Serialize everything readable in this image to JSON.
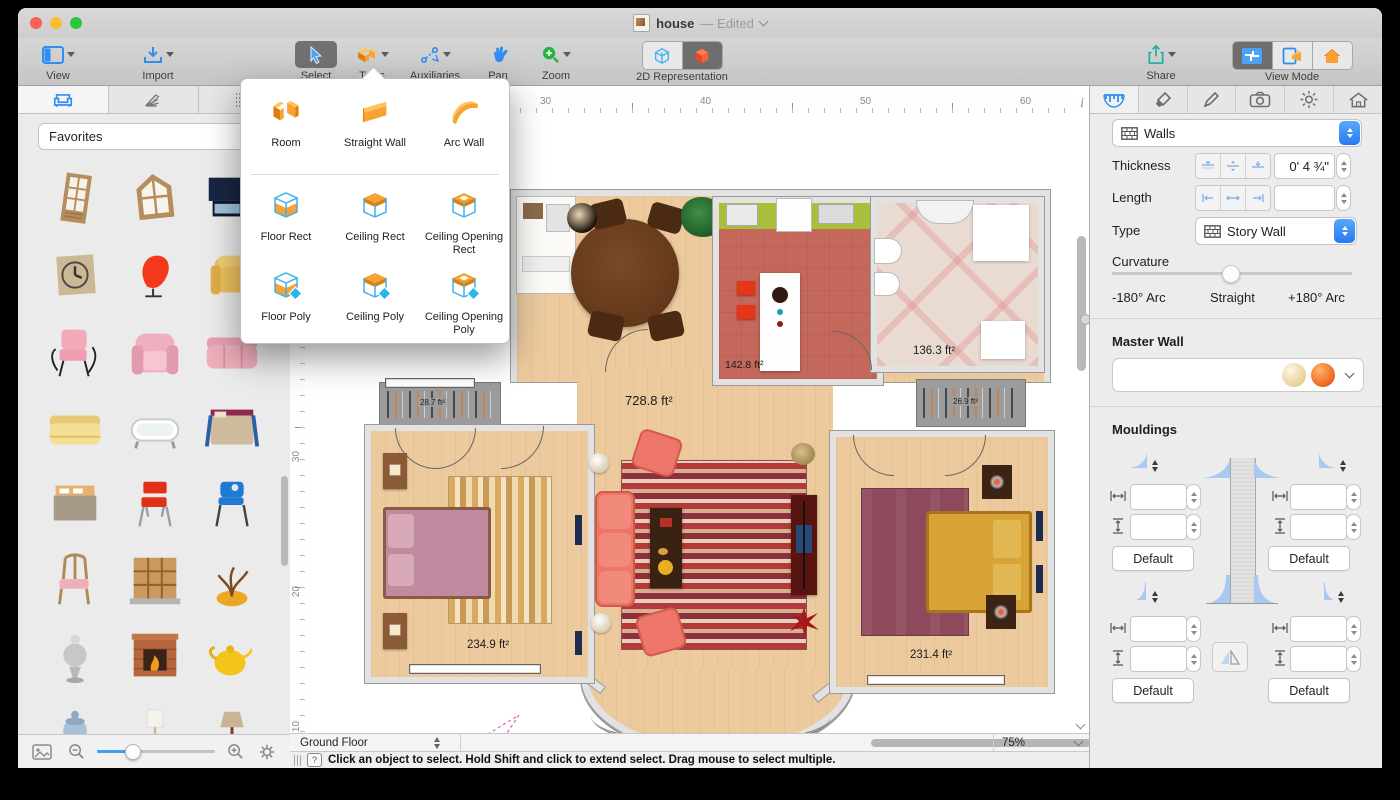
{
  "window": {
    "title": "house",
    "edited_suffix": "— Edited"
  },
  "toolbar": {
    "view": "View",
    "import": "Import",
    "select": "Select",
    "tools": "Tools",
    "auxiliaries": "Auxiliaries",
    "pan": "Pan",
    "zoom": "Zoom",
    "representation_2d": "2D Representation",
    "share": "Share",
    "view_mode": "View Mode"
  },
  "tools_popover": {
    "items": [
      {
        "label": "Room"
      },
      {
        "label": "Straight Wall"
      },
      {
        "label": "Arc Wall"
      },
      {
        "label": "Floor Rect"
      },
      {
        "label": "Ceiling Rect"
      },
      {
        "label": "Ceiling Opening Rect"
      },
      {
        "label": "Floor Poly"
      },
      {
        "label": "Ceiling Poly"
      },
      {
        "label": "Ceiling Opening Poly"
      }
    ]
  },
  "library": {
    "category": "Favorites",
    "items": [
      "door",
      "arched-window",
      "tv-stand",
      "wall-clock",
      "egg-chair",
      "armchair-yellow",
      "chair-pink-metal",
      "armchair-pink",
      "sofa-pink",
      "sofa-yellow",
      "bathtub",
      "bed-blue",
      "bed-gray",
      "chair-red",
      "chair-blue",
      "chair-wood",
      "shelving-unit",
      "bonsai-tree",
      "samovar",
      "fireplace",
      "teapot",
      "jar-blue",
      "floor-lamp",
      "table-lamp"
    ]
  },
  "canvas": {
    "ruler_top": [
      "30",
      "40",
      "50",
      "60"
    ],
    "ruler_left": [
      "30",
      "20",
      "10"
    ],
    "info_glyph": "i",
    "areas": {
      "living": "728.8 ft²",
      "kitchen": "142.8 ft²",
      "bathroom": "136.3 ft²",
      "bedroom_left": "234.9 ft²",
      "bedroom_right": "231.4 ft²",
      "wardrobe": "28.7 ft²",
      "closet": "26.9 ft²"
    },
    "floor_selector": "Ground Floor",
    "zoom_level": "75%"
  },
  "status_bar": {
    "help_glyph": "?",
    "message": "Click an object to select. Hold Shift and click to extend select. Drag mouse to select multiple."
  },
  "inspector": {
    "category_selector": "Walls",
    "thickness": {
      "label": "Thickness",
      "value": "0' 4 ¾\""
    },
    "length": {
      "label": "Length",
      "value": ""
    },
    "type": {
      "label": "Type",
      "value": "Story Wall"
    },
    "curvature": {
      "label": "Curvature",
      "min": "-180° Arc",
      "mid": "Straight",
      "max": "+180° Arc"
    },
    "master_wall_label": "Master Wall",
    "mouldings_label": "Mouldings",
    "default_button": "Default"
  },
  "colors": {
    "accent_blue": "#2f8df5",
    "tool_orange": "#f6a331",
    "share_teal": "#15b0a6",
    "zoom_green": "#27b43c",
    "selected_gray": "#6e6e6e"
  }
}
